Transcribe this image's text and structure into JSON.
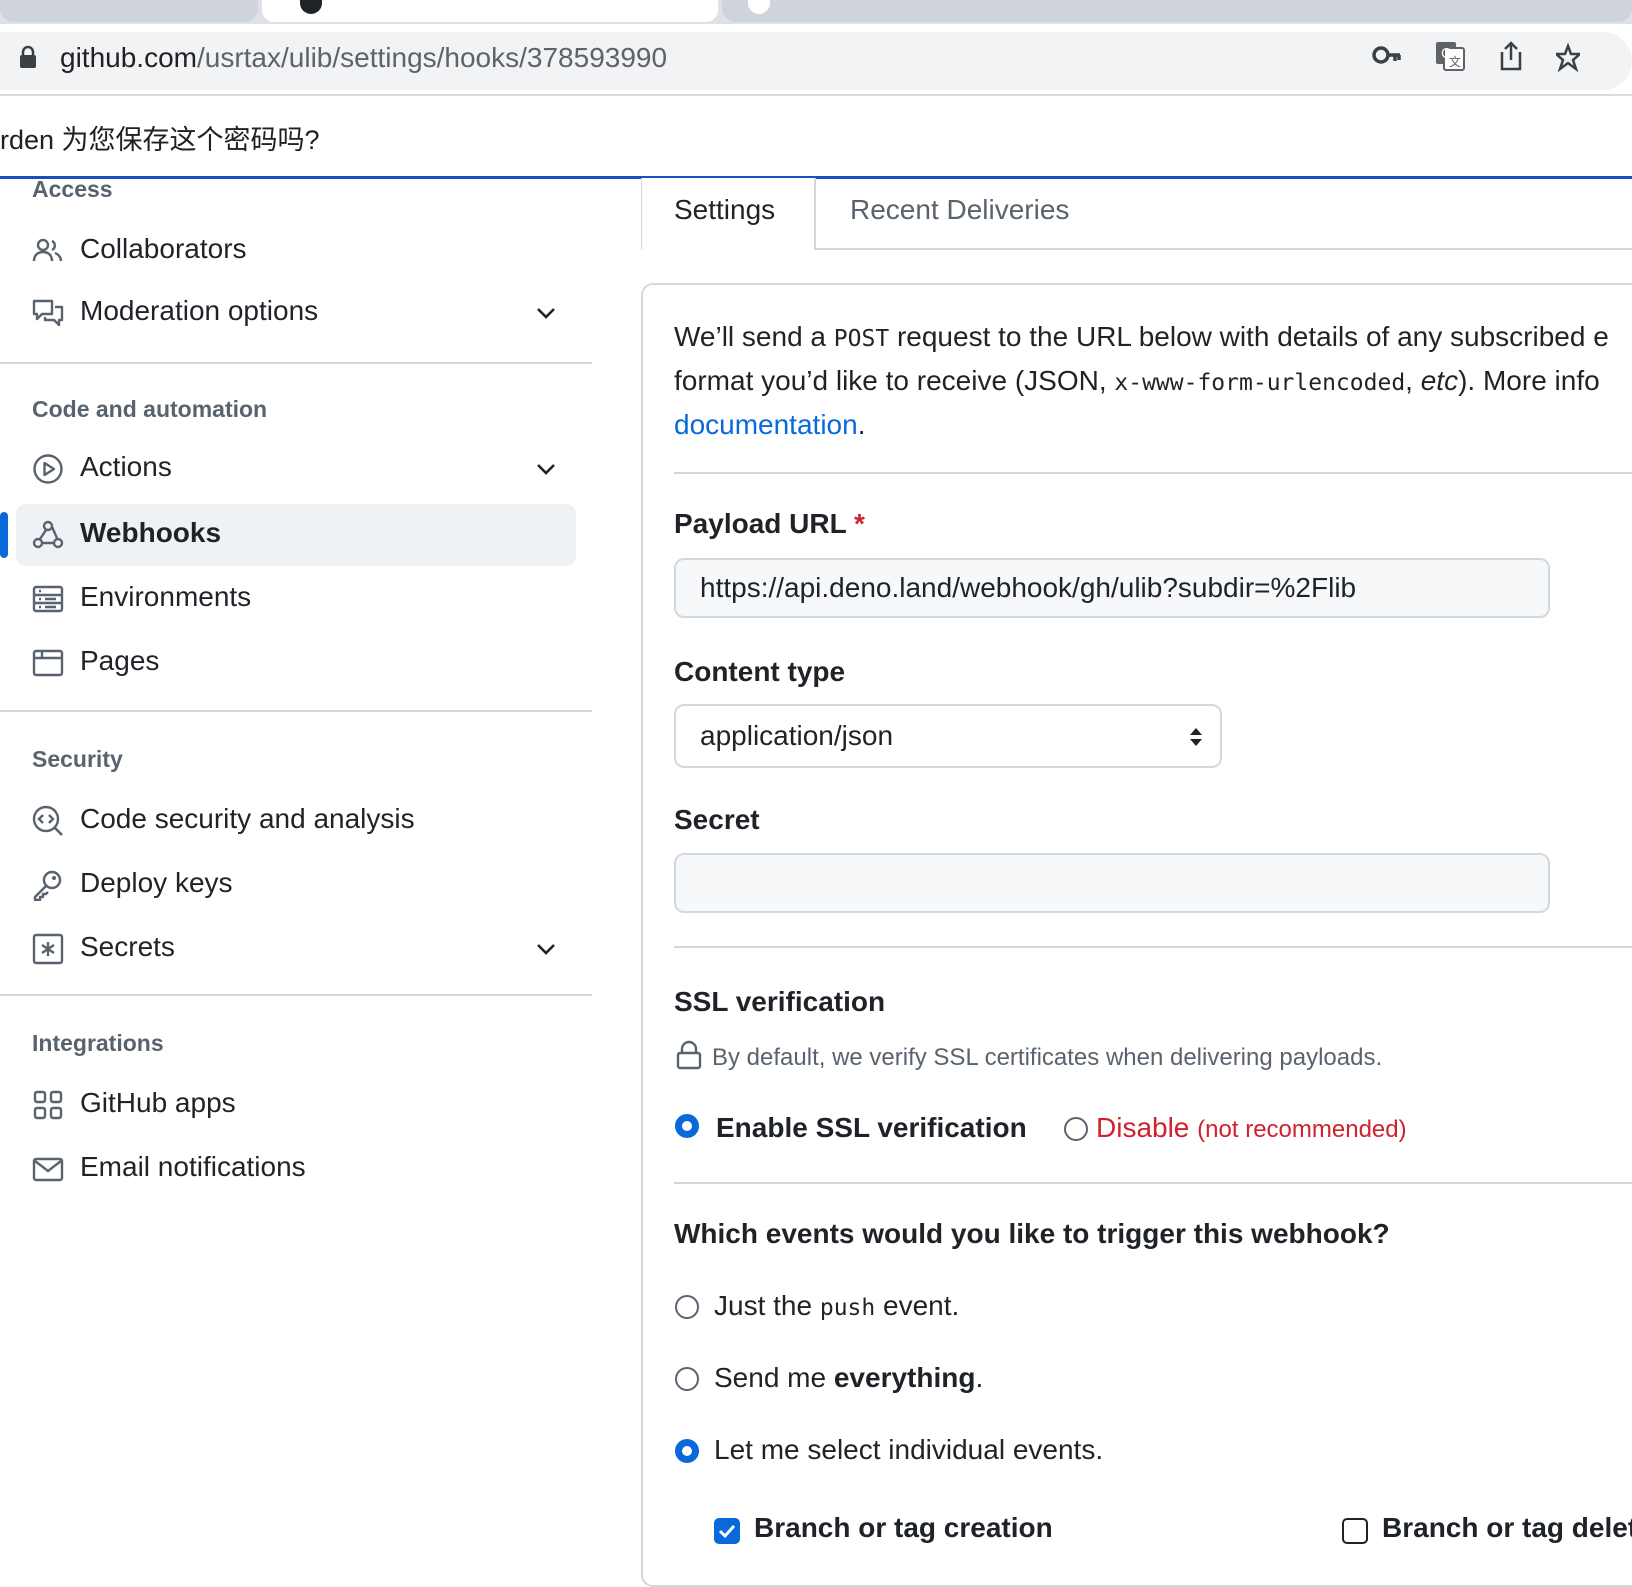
{
  "browser": {
    "url_host": "github.com",
    "url_path": "/usrtax/ulib/settings/hooks/378593990",
    "password_prompt": "rden 为您保存这个密码吗?"
  },
  "sidebar": {
    "items": [
      {
        "label": "Collaborators"
      },
      {
        "label": "Moderation options"
      },
      {
        "label": "Actions"
      },
      {
        "label": "Webhooks"
      },
      {
        "label": "Environments"
      },
      {
        "label": "Pages"
      },
      {
        "label": "Code security and analysis"
      },
      {
        "label": "Deploy keys"
      },
      {
        "label": "Secrets"
      },
      {
        "label": "GitHub apps"
      },
      {
        "label": "Email notifications"
      }
    ],
    "sections": {
      "access": "Access",
      "code_automation": "Code and automation",
      "security": "Security",
      "integrations": "Integrations"
    }
  },
  "main": {
    "tabs": [
      {
        "label": "Settings"
      },
      {
        "label": "Recent Deliveries"
      }
    ],
    "intro": {
      "part1": "We’ll send a ",
      "post": "POST",
      "part2": " request to the URL below with details of any subscribed e",
      "part3": "format you’d like to receive (JSON, ",
      "urlencoded": "x-www-form-urlencoded",
      "part4": ", ",
      "etc": "etc",
      "part5": "). More info",
      "doc_link": "documentation",
      "period": "."
    },
    "payload_url": {
      "label": "Payload URL",
      "required_mark": "*",
      "value": "https://api.deno.land/webhook/gh/ulib?subdir=%2Flib"
    },
    "content_type": {
      "label": "Content type",
      "value": "application/json"
    },
    "secret": {
      "label": "Secret",
      "value": ""
    },
    "ssl": {
      "heading": "SSL verification",
      "note": "By default, we verify SSL certificates when delivering payloads.",
      "enable": "Enable SSL verification",
      "disable": "Disable",
      "not_recommended": "(not recommended)",
      "selected": "enable"
    },
    "events": {
      "heading": "Which events would you like to trigger this webhook?",
      "just_the": "Just the ",
      "push": "push",
      "event": " event.",
      "send_me": "Send me ",
      "everything": "everything",
      "period": ".",
      "select_individual": "Let me select individual events.",
      "selected": "individual",
      "checkboxes": [
        {
          "label": "Branch or tag creation",
          "checked": true
        },
        {
          "label": "Branch or tag delet",
          "checked": false
        }
      ]
    }
  }
}
